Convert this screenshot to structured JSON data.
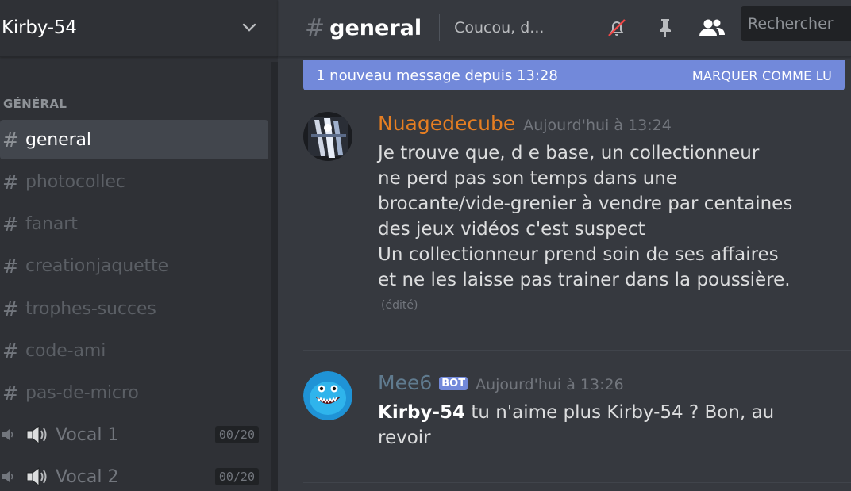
{
  "server": {
    "name": "Kirby-54"
  },
  "sidebar": {
    "category": "GÉNÉRAL",
    "channels": [
      {
        "label": "general"
      },
      {
        "label": "photocollec"
      },
      {
        "label": "fanart"
      },
      {
        "label": "creationjaquette"
      },
      {
        "label": "trophes-succes"
      },
      {
        "label": "code-ami"
      },
      {
        "label": "pas-de-micro"
      }
    ],
    "voice": [
      {
        "label": "Vocal 1",
        "count": "00/20"
      },
      {
        "label": "Vocal 2",
        "count": "00/20"
      }
    ]
  },
  "header": {
    "hash": "#",
    "channel": "general",
    "topic": "Coucou, d...",
    "search_placeholder": "Rechercher"
  },
  "banner": {
    "text": "1 nouveau message depuis 13:28",
    "action": "MARQUER COMME LU"
  },
  "messages": [
    {
      "author": "Nuagedecube",
      "author_color": "#e67e22",
      "timestamp": "Aujourd'hui à 13:24",
      "lines": [
        "Je trouve que, d e base, un collectionneur",
        "ne perd pas son temps dans une",
        "brocante/vide-grenier à vendre par centaines",
        "des jeux vidéos c'est suspect",
        "Un collectionneur prend soin de ses affaires",
        "et ne les laisse pas trainer dans la poussière."
      ],
      "edited": "(édité)"
    },
    {
      "author": "Mee6",
      "author_color": "#607b8f",
      "bot_tag": "BOT",
      "timestamp": "Aujourd'hui à 13:26",
      "mention": "Kirby-54",
      "line1_rest": " tu n'aime plus Kirby-54 ? Bon, au",
      "line2": "revoir"
    }
  ],
  "colors": {
    "accent": "#7289da",
    "sidebar_bg": "#2f3136",
    "main_bg": "#36393f"
  }
}
